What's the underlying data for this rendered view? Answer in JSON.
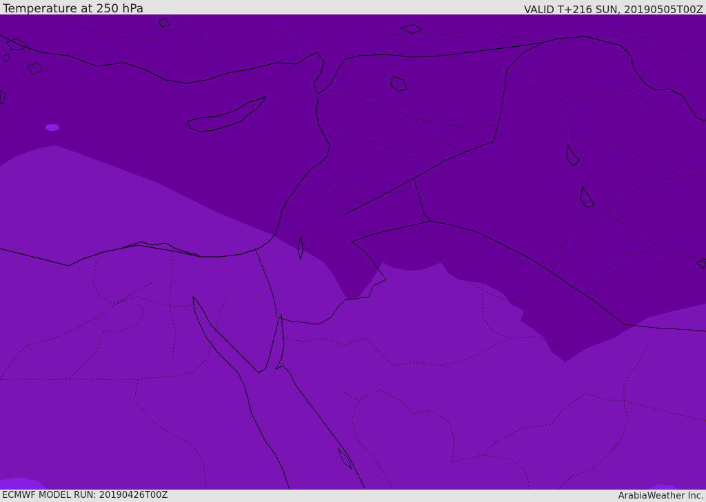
{
  "header": {
    "title": "Temperature at 250 hPa",
    "valid_time": "VALID T+216 SUN, 20190505T00Z"
  },
  "footer": {
    "model_run": "ECMWF MODEL RUN: 20190426T00Z",
    "brand": "ArabiaWeather Inc."
  },
  "colors": {
    "cold_zone": "#660099",
    "warm_zone": "#7a14b4",
    "corner_zone": "#8a1ee0",
    "coastline": "#000000"
  }
}
